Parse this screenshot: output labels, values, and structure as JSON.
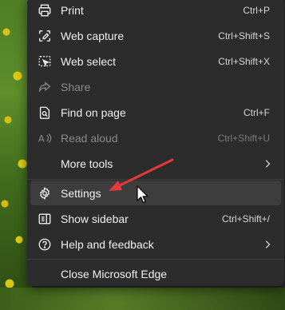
{
  "menu": {
    "items": [
      {
        "label": "Print",
        "shortcut": "Ctrl+P",
        "icon": "print-icon",
        "disabled": false
      },
      {
        "label": "Web capture",
        "shortcut": "Ctrl+Shift+S",
        "icon": "web-capture-icon",
        "disabled": false
      },
      {
        "label": "Web select",
        "shortcut": "Ctrl+Shift+X",
        "icon": "web-select-icon",
        "disabled": false
      },
      {
        "label": "Share",
        "shortcut": "",
        "icon": "share-icon",
        "disabled": true
      },
      {
        "label": "Find on page",
        "shortcut": "Ctrl+F",
        "icon": "find-icon",
        "disabled": false
      },
      {
        "label": "Read aloud",
        "shortcut": "Ctrl+Shift+U",
        "icon": "read-aloud-icon",
        "disabled": true
      },
      {
        "label": "More tools",
        "shortcut": "",
        "icon": "",
        "submenu": true
      },
      {
        "label": "Settings",
        "shortcut": "",
        "icon": "gear-icon",
        "highlighted": true
      },
      {
        "label": "Show sidebar",
        "shortcut": "Ctrl+Shift+/",
        "icon": "sidebar-icon"
      },
      {
        "label": "Help and feedback",
        "shortcut": "",
        "icon": "help-icon",
        "submenu": true
      },
      {
        "label": "Close Microsoft Edge",
        "shortcut": "",
        "icon": ""
      }
    ]
  },
  "colors": {
    "annotation_arrow": "#e03a3a",
    "menu_bg": "#2c2c2c"
  }
}
